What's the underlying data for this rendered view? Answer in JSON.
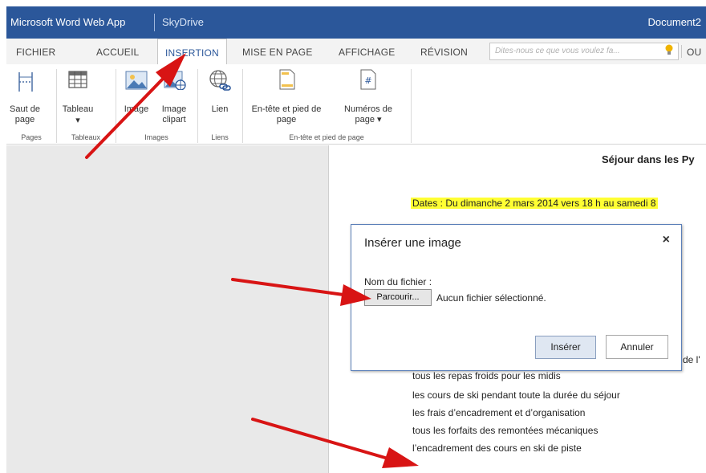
{
  "titlebar": {
    "app": "Microsoft Word Web App",
    "service": "SkyDrive",
    "document": "Document2"
  },
  "tabs": [
    {
      "label": "FICHIER"
    },
    {
      "label": "ACCUEIL"
    },
    {
      "label": "INSERTION"
    },
    {
      "label": "MISE EN PAGE"
    },
    {
      "label": "AFFICHAGE"
    },
    {
      "label": "RÉVISION"
    }
  ],
  "active_tab": "INSERTION",
  "tellme": {
    "placeholder": "Dites-nous ce que vous voulez fa..."
  },
  "tab_truncated": "OU",
  "ribbon": {
    "buttons": {
      "page_break": "Saut de\npage",
      "table": "Tableau",
      "table_arrow": "▾",
      "image": "Image",
      "clipart": "Image\nclipart",
      "link": "Lien",
      "header_footer": "En-tête et pied de\npage",
      "page_numbers": "Numéros de\npage ▾"
    },
    "groups": {
      "pages": "Pages",
      "tables": "Tableaux",
      "images": "Images",
      "links": "Liens",
      "header_footer": "En-tête et pied de page"
    }
  },
  "document": {
    "title": "Séjour dans les Py",
    "dates": "Dates :  Du dimanche 2 mars 2014 vers 18 h au samedi 8",
    "fragment": "de l'",
    "lines": [
      "tous les repas froids pour les midis",
      "les cours de ski pendant toute la durée du séjour",
      "les frais d’encadrement et d’organisation",
      "tous les forfaits des remontées mécaniques",
      "l’encadrement des  cours en ski de piste"
    ]
  },
  "dialog": {
    "title": "Insérer une image",
    "close": "×",
    "file_label": "Nom du fichier :",
    "browse": "Parcourir...",
    "no_file": "Aucun fichier sélectionné.",
    "insert": "Insérer",
    "cancel": "Annuler"
  },
  "colors": {
    "accent": "#2b579a",
    "highlight": "#ffff33",
    "arrow": "#e11414",
    "workspace": "#e9e9e9"
  }
}
